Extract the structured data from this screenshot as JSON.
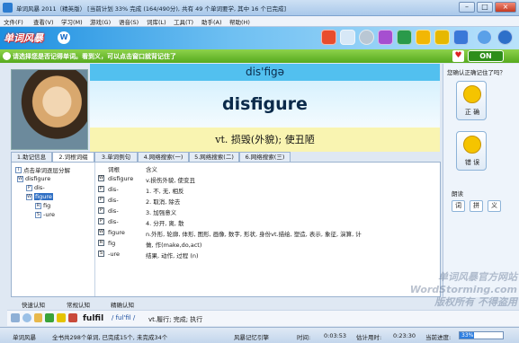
{
  "window": {
    "title": "单词风暴 2011（精英版） [当前计划 33% 完成 (164/490分), 共有 49 个单词要学, 其中 16 个已完成]",
    "minimize": "–",
    "maximize": "□",
    "close": "×"
  },
  "menu": [
    "文件(F)",
    "查看(V)",
    "学习(M)",
    "游戏(G)",
    "语音(S)",
    "词库(L)",
    "工具(T)",
    "助手(A)",
    "帮助(H)"
  ],
  "banner": {
    "logo": "单词风暴"
  },
  "tip": {
    "text": "请选择您是否记得单词。看到义，可以点击窗口就背记住了",
    "toggle": "ON"
  },
  "word": {
    "phonetic": "dis'figə",
    "headword": "disfigure",
    "meaning": "vt. 损毁(外貌); 使丑陋"
  },
  "right_panel": {
    "question": "您确认正确记住了吗？",
    "correct": "正 确",
    "wrong": "错 误",
    "read_label": "朗读",
    "read_buttons": [
      "词",
      "拼",
      "义"
    ]
  },
  "tabs": [
    "1.助记信息",
    "2.词根词缀",
    "3.单词例句",
    "4.网络搜索(一)",
    "5.网络搜索(二)",
    "6.网络搜索(三)"
  ],
  "tree": {
    "title": "点击单词逐层分解",
    "nodes": [
      "disfigure",
      "dis-",
      "figure",
      "fig",
      "-ure"
    ]
  },
  "table": {
    "headers": [
      "词根",
      "含义"
    ],
    "rows": [
      {
        "icon": "W",
        "root": "disfigure",
        "def": "v.损伤外貌, 使变丑"
      },
      {
        "icon": "P",
        "root": "dis-",
        "def": "1. 不, 无, 相反"
      },
      {
        "icon": "P",
        "root": "dis-",
        "def": "2. 取消, 除去"
      },
      {
        "icon": "P",
        "root": "dis-",
        "def": "3. 加强意义"
      },
      {
        "icon": "P",
        "root": "dis-",
        "def": "4. 分开, 离, 散"
      },
      {
        "icon": "W",
        "root": "figure",
        "def": "n.外形, 轮廓, 体形, 图形, 画像, 数字, 形状, 身份vt.描绘, 塑造, 表示, 象征, 演算, 计"
      },
      {
        "icon": "R",
        "root": "fig",
        "def": "做, 作(make,do,act)"
      },
      {
        "icon": "S",
        "root": "-ure",
        "def": "结果, 动作, 过程 (n)"
      }
    ]
  },
  "quick_tabs": [
    "快速认知",
    "常规认知",
    "精确认知"
  ],
  "word_bar": {
    "word": "fulfil",
    "phonetic": "/ ful'fil /",
    "meaning": "vt.履行; 完成; 执行"
  },
  "status": {
    "app": "单词风暴",
    "progress_text": "全书共298个单词, 已完成15个, 未完成34个",
    "engine": "风暴记忆引擎",
    "time_label": "时间:",
    "time": "0:03:53",
    "estimate_label": "估计用时:",
    "estimate": "0:23:30",
    "today_label": "当前进度:",
    "percent": "33%",
    "percent_value": 0.33
  },
  "watermark": [
    "单词风暴官方网站",
    "WordStorming.com",
    "版权所有 不得盗用"
  ],
  "colors": {
    "accent": "#1d8fe0",
    "tip": "#56aa1e",
    "meaning_bg": "#f9f4b1",
    "phonetic_bg": "#52c0ef"
  }
}
